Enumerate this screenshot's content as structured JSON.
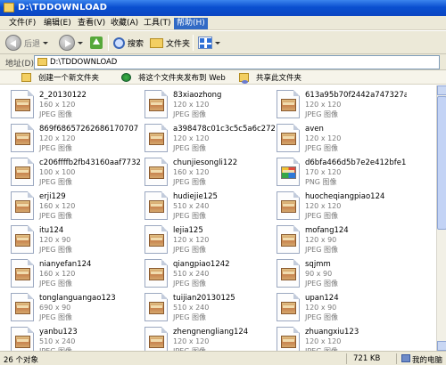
{
  "window": {
    "title": "D:\\TDDOWNLOAD"
  },
  "menu": [
    "文件(F)",
    "编辑(E)",
    "查看(V)",
    "收藏(A)",
    "工具(T)",
    "帮助(H)"
  ],
  "toolbar": {
    "back": "后退",
    "search": "搜索",
    "folders": "文件夹"
  },
  "address": {
    "label": "地址(D)",
    "value": "D:\\TDDOWNLOAD"
  },
  "tasks": {
    "new_folder": "创建一个新文件夹",
    "publish": "将这个文件夹发布到 Web",
    "share": "共享此文件夹"
  },
  "files": [
    {
      "name": "2_20130122",
      "dims": "160 x 120",
      "type": "JPEG 图像",
      "icon": "jpeg-image-icon"
    },
    {
      "name": "83xiaozhong",
      "dims": "120 x 120",
      "type": "JPEG 图像",
      "icon": "jpeg-image-icon"
    },
    {
      "name": "613a95b70f2442a747327a1e...",
      "dims": "120 x 120",
      "type": "JPEG 图像",
      "icon": "jpeg-image-icon"
    },
    {
      "name": "869f68657262686170707 9eb2b",
      "dims": "120 x 120",
      "type": "JPEG 图像",
      "icon": "jpeg-image-icon"
    },
    {
      "name": "a398478c01c3c5c5a6c2724b",
      "dims": "120 x 120",
      "type": "JPEG 图像",
      "icon": "jpeg-image-icon"
    },
    {
      "name": "aven",
      "dims": "120 x 120",
      "type": "JPEG 图像",
      "icon": "jpeg-image-icon"
    },
    {
      "name": "c206ffffb2fb43160aaf773220...",
      "dims": "100 x 100",
      "type": "JPEG 图像",
      "icon": "jpeg-image-icon"
    },
    {
      "name": "chunjiesongli122",
      "dims": "160 x 120",
      "type": "JPEG 图像",
      "icon": "jpeg-image-icon"
    },
    {
      "name": "d6bfa466d5b7e2e412bfe16fc...",
      "dims": "170 x 120",
      "type": "PNG 图像",
      "icon": "png-image-icon"
    },
    {
      "name": "erji129",
      "dims": "160 x 120",
      "type": "JPEG 图像",
      "icon": "jpeg-image-icon"
    },
    {
      "name": "hudiejie125",
      "dims": "510 x 240",
      "type": "JPEG 图像",
      "icon": "jpeg-image-icon"
    },
    {
      "name": "huocheqiangpiao124",
      "dims": "120 x 120",
      "type": "JPEG 图像",
      "icon": "jpeg-image-icon"
    },
    {
      "name": "itu124",
      "dims": "120 x 90",
      "type": "JPEG 图像",
      "icon": "jpeg-image-icon"
    },
    {
      "name": "lejia125",
      "dims": "120 x 120",
      "type": "JPEG 图像",
      "icon": "jpeg-image-icon"
    },
    {
      "name": "mofang124",
      "dims": "120 x 90",
      "type": "JPEG 图像",
      "icon": "jpeg-image-icon"
    },
    {
      "name": "nianyefan124",
      "dims": "160 x 120",
      "type": "JPEG 图像",
      "icon": "jpeg-image-icon"
    },
    {
      "name": "qiangpiao1242",
      "dims": "510 x 240",
      "type": "JPEG 图像",
      "icon": "jpeg-image-icon"
    },
    {
      "name": "sqjmm",
      "dims": "90 x 90",
      "type": "JPEG 图像",
      "icon": "jpeg-image-icon"
    },
    {
      "name": "tonglanguangao123",
      "dims": "690 x 90",
      "type": "JPEG 图像",
      "icon": "jpeg-image-icon"
    },
    {
      "name": "tuijian20130125",
      "dims": "510 x 240",
      "type": "JPEG 图像",
      "icon": "jpeg-image-icon"
    },
    {
      "name": "upan124",
      "dims": "120 x 90",
      "type": "JPEG 图像",
      "icon": "jpeg-image-icon"
    },
    {
      "name": "yanbu123",
      "dims": "510 x 240",
      "type": "JPEG 图像",
      "icon": "jpeg-image-icon"
    },
    {
      "name": "zhengnengliang124",
      "dims": "120 x 120",
      "type": "JPEG 图像",
      "icon": "jpeg-image-icon"
    },
    {
      "name": "zhuangxiu123",
      "dims": "120 x 120",
      "type": "JPEG 图像",
      "icon": "jpeg-image-icon"
    }
  ],
  "status": {
    "count": "26 个对象",
    "size": "721 KB",
    "location": "我的电脑"
  }
}
